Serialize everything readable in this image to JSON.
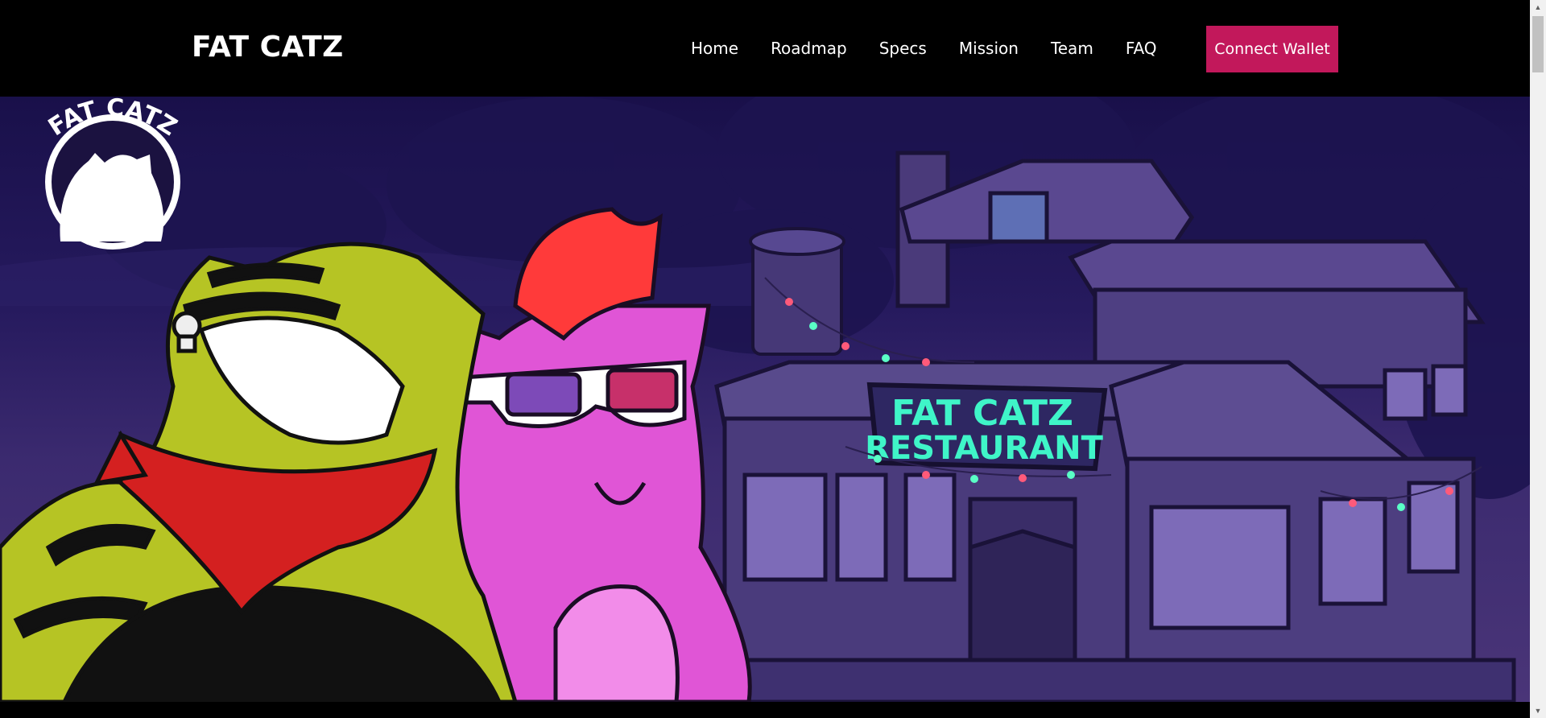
{
  "header": {
    "brand": "FAT CATZ",
    "nav": [
      "Home",
      "Roadmap",
      "Specs",
      "Mission",
      "Team",
      "FAQ"
    ],
    "connect_label": "Connect Wallet"
  },
  "hero": {
    "logo_text": "FAT CATZ",
    "sign_line1": "FAT CATZ",
    "sign_line2": "RESTAURANT"
  },
  "colors": {
    "accent": "#c2185b",
    "background": "#000000",
    "sign": "#3ff5c8"
  },
  "icons": {
    "scroll_up": "chevron-up-icon",
    "scroll_down": "chevron-down-icon"
  }
}
